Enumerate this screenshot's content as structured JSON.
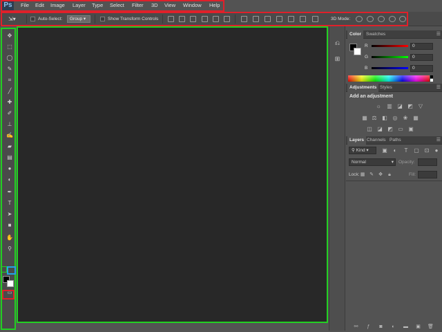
{
  "app": {
    "logo": "Ps"
  },
  "menu": [
    "File",
    "Edit",
    "Image",
    "Layer",
    "Type",
    "Select",
    "Filter",
    "3D",
    "View",
    "Window",
    "Help"
  ],
  "options": {
    "tool_icon": "move-tool-icon",
    "auto_select_label": "Auto-Select:",
    "auto_select_value": "Group",
    "show_transform_label": "Show Transform Controls",
    "mode_3d_label": "3D Mode:"
  },
  "tools": [
    "move-tool",
    "marquee-tool",
    "lasso-tool",
    "quick-selection-tool",
    "crop-tool",
    "eyedropper-tool",
    "spot-healing-tool",
    "brush-tool",
    "clone-stamp-tool",
    "history-brush-tool",
    "eraser-tool",
    "gradient-tool",
    "blur-tool",
    "dodge-tool",
    "pen-tool",
    "type-tool",
    "path-selection-tool",
    "rectangle-tool",
    "hand-tool",
    "zoom-tool"
  ],
  "colors": {
    "foreground": "#000000",
    "background": "#ffffff",
    "highlight_red": "#e0202a",
    "highlight_green": "#22d022",
    "highlight_blue": "#22a6e6"
  },
  "color_panel": {
    "tabs": [
      "Color",
      "Swatches"
    ],
    "channels": [
      {
        "label": "R",
        "value": "0"
      },
      {
        "label": "G",
        "value": "0"
      },
      {
        "label": "B",
        "value": "0"
      }
    ]
  },
  "adjustments_panel": {
    "tabs": [
      "Adjustments",
      "Styles"
    ],
    "heading": "Add an adjustment"
  },
  "layers_panel": {
    "tabs": [
      "Layers",
      "Channels",
      "Paths"
    ],
    "filter_kind": "Kind",
    "blend_mode": "Normal",
    "opacity_label": "Opacity:",
    "lock_label": "Lock:",
    "fill_label": "Fill:"
  }
}
